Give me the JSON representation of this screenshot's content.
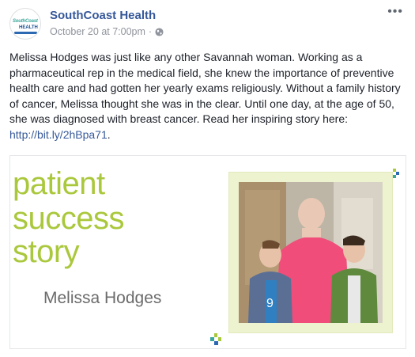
{
  "post": {
    "page_name": "SouthCoast Health",
    "timestamp": "October 20 at 7:00pm",
    "separator": "·",
    "more_label": "•••",
    "avatar": {
      "logo_top": "SouthCoast",
      "logo_bottom": "HEALTH"
    },
    "body_text": "Melissa Hodges was just like any other Savannah woman. Working as a pharmaceutical rep in the medical field, she knew the importance of preventive health care and had gotten her yearly exams religiously. Without a family history of cancer, Melissa thought she was in the clear. Until one day, at the age of 50, she was diagnosed with breast cancer. Read her inspiring story here: ",
    "link_text": "http://bit.ly/2hBpa71",
    "body_end": "."
  },
  "image": {
    "line1": "patient",
    "line2": "success",
    "line3": "story",
    "person_name": "Melissa Hodges"
  },
  "colors": {
    "page_name": "#365899",
    "meta": "#90949c",
    "accent_green": "#aac83c",
    "frame_bg": "#eef3cf",
    "shirt_pink": "#f04d7a"
  },
  "icons": {
    "privacy": "globe-icon",
    "more": "more-options-icon"
  }
}
